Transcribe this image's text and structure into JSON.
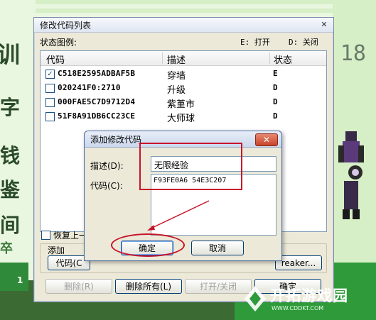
{
  "game": {
    "left_glyphs": [
      "训",
      "字",
      "钱",
      "鉴",
      "间",
      "卒"
    ],
    "right_number": "18",
    "bottom_left_digit": "1"
  },
  "main_window": {
    "title": "修改代码列表",
    "close_glyph": "✕",
    "legend_label": "状态图例:",
    "legend_on": "E: 打开",
    "legend_off": "D: 关闭",
    "columns": [
      "代码",
      "描述",
      "状态"
    ],
    "rows": [
      {
        "checked": true,
        "code": "C518E2595ADBAF5B",
        "desc": "穿墙",
        "status": "E"
      },
      {
        "checked": false,
        "code": "020241F0:2710",
        "desc": "升级",
        "status": "D"
      },
      {
        "checked": false,
        "code": "000FAE5C7D9712D4",
        "desc": "紫堇市",
        "status": "D"
      },
      {
        "checked": false,
        "code": "51F8A91DB6CC23CE",
        "desc": "大师球",
        "status": "D"
      }
    ],
    "restore_label": "恢复上一",
    "add_group_label": "添加",
    "buttons": {
      "code": "代码(C",
      "breaker": "reaker...",
      "delete": "删除(R)",
      "delete_all": "删除所有(L)",
      "toggle": "打开/关闭",
      "ok": "确定"
    }
  },
  "dialog": {
    "title": "添加修改代码",
    "close_glyph": "✕",
    "desc_label": "描述(D):",
    "desc_value": "无限经验",
    "code_label": "代码(C):",
    "code_value": "F93FE0A6 54E3C207",
    "ok_label": "确定",
    "cancel_label": "取消"
  },
  "watermark": {
    "title": "开拓游戏园",
    "url": "WWW.CDDKT.COM"
  },
  "colors": {
    "annotation_red": "#c8142a",
    "watermark_green": "#2f9a3a"
  }
}
